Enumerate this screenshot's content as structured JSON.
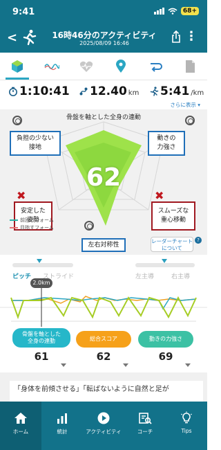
{
  "status_bar": {
    "time": "9:41",
    "battery": "68+"
  },
  "header": {
    "title": "16時46分のアクティビティ",
    "date": "2025/08/09 16:46"
  },
  "tabs": [
    {
      "icon": "gem-icon",
      "active": true
    },
    {
      "icon": "wave-icon",
      "active": false
    },
    {
      "icon": "heart-icon",
      "active": false
    },
    {
      "icon": "map-pin-icon",
      "active": false
    },
    {
      "icon": "loop-icon",
      "active": false
    },
    {
      "icon": "document-icon",
      "active": false
    }
  ],
  "metrics": {
    "time": "1:10:41",
    "distance": "12.40",
    "distance_unit": "km",
    "pace": "5:41",
    "pace_unit": "/km",
    "more_label": "さらに表示"
  },
  "radar": {
    "title": "骨盤を軸とした全身の連動",
    "score": "62",
    "labels": {
      "top_left": "負担の少ない\n接地",
      "top_right": "動きの\n力強さ",
      "left": "安定した\n姿勢",
      "right": "スムーズな\n重心移動",
      "bottom": "左右対称性"
    },
    "legend": [
      "前回のフォーム",
      "目指すフォーム"
    ],
    "legend_colors": [
      "#2bb3a6",
      "#e57373"
    ],
    "chart_link": "レーダーチャート\nについて",
    "help": "?"
  },
  "sliders": {
    "left": [
      "ピッチ",
      "ストライド"
    ],
    "right": [
      "左主導",
      "右主導"
    ]
  },
  "line_chart": {
    "marker_label": "2.0km"
  },
  "scores": [
    {
      "label": "骨盤を軸とした\n全身の連動",
      "value": "61",
      "color": "#26b7c9"
    },
    {
      "label": "総合スコア",
      "value": "62",
      "color": "#f6a11a"
    },
    {
      "label": "動きの力強さ",
      "value": "69",
      "color": "#3cc1a4"
    }
  ],
  "text_card": "「身体を前傾させる」「転ばないように自然と足が",
  "nav": [
    {
      "icon": "home-icon",
      "label": "ホーム",
      "active": true
    },
    {
      "icon": "stats-icon",
      "label": "統計",
      "active": false
    },
    {
      "icon": "activity-icon",
      "label": "アクティビティ",
      "active": false
    },
    {
      "icon": "coach-icon",
      "label": "コーチ",
      "active": false
    },
    {
      "icon": "tips-icon",
      "label": "Tips",
      "active": false
    }
  ]
}
